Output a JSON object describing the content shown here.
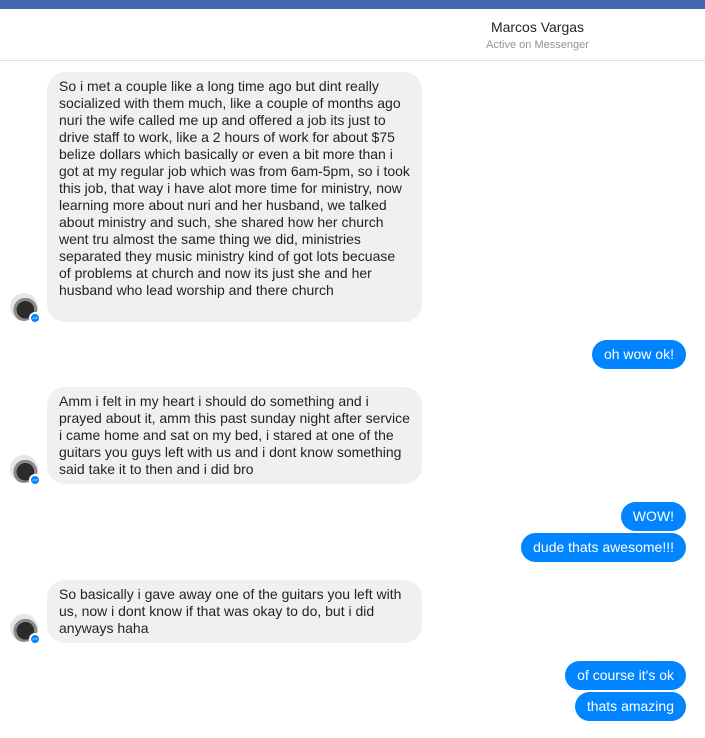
{
  "header": {
    "contact_name": "Marcos Vargas",
    "status": "Active on Messenger"
  },
  "colors": {
    "brand_bar": "#4267b2",
    "outgoing_bubble": "#0084ff",
    "incoming_bubble": "#f1f0f0"
  },
  "messages": [
    {
      "sender": "contact",
      "text": "So i met a couple like a long time ago but dint really socialized with them much, like a couple of months ago nuri the wife called me up and offered a job its just to drive staff to work, like a 2 hours of work for about $75 belize dollars which basically or even a bit more than i got at my regular job which was from 6am-5pm, so i took this job, that way i have alot more time for ministry, now learning more about nuri and her husband, we talked about ministry and such, she shared how her church went tru almost the same thing we did, ministries separated they music ministry kind of got lots becuase of problems at church and now its just she and her husband who lead worship and there church"
    },
    {
      "sender": "me",
      "text": "oh wow ok!"
    },
    {
      "sender": "contact",
      "text": "Amm i felt in my heart i should do something and i prayed about it, amm this past sunday night after service i came home and sat on my bed, i stared at one of the guitars you guys left with us and i dont know something said take it to then and i did bro"
    },
    {
      "sender": "me",
      "text": "WOW!"
    },
    {
      "sender": "me",
      "text": "dude thats awesome!!!"
    },
    {
      "sender": "contact",
      "text": "So basically i gave away one of the guitars you left with us, now i dont know if that was okay to do, but i did anyways haha"
    },
    {
      "sender": "me",
      "text": "of course it's ok"
    },
    {
      "sender": "me",
      "text": "thats amazing"
    }
  ],
  "icons": {
    "avatar": "contact-avatar",
    "badge": "messenger-badge-icon"
  }
}
